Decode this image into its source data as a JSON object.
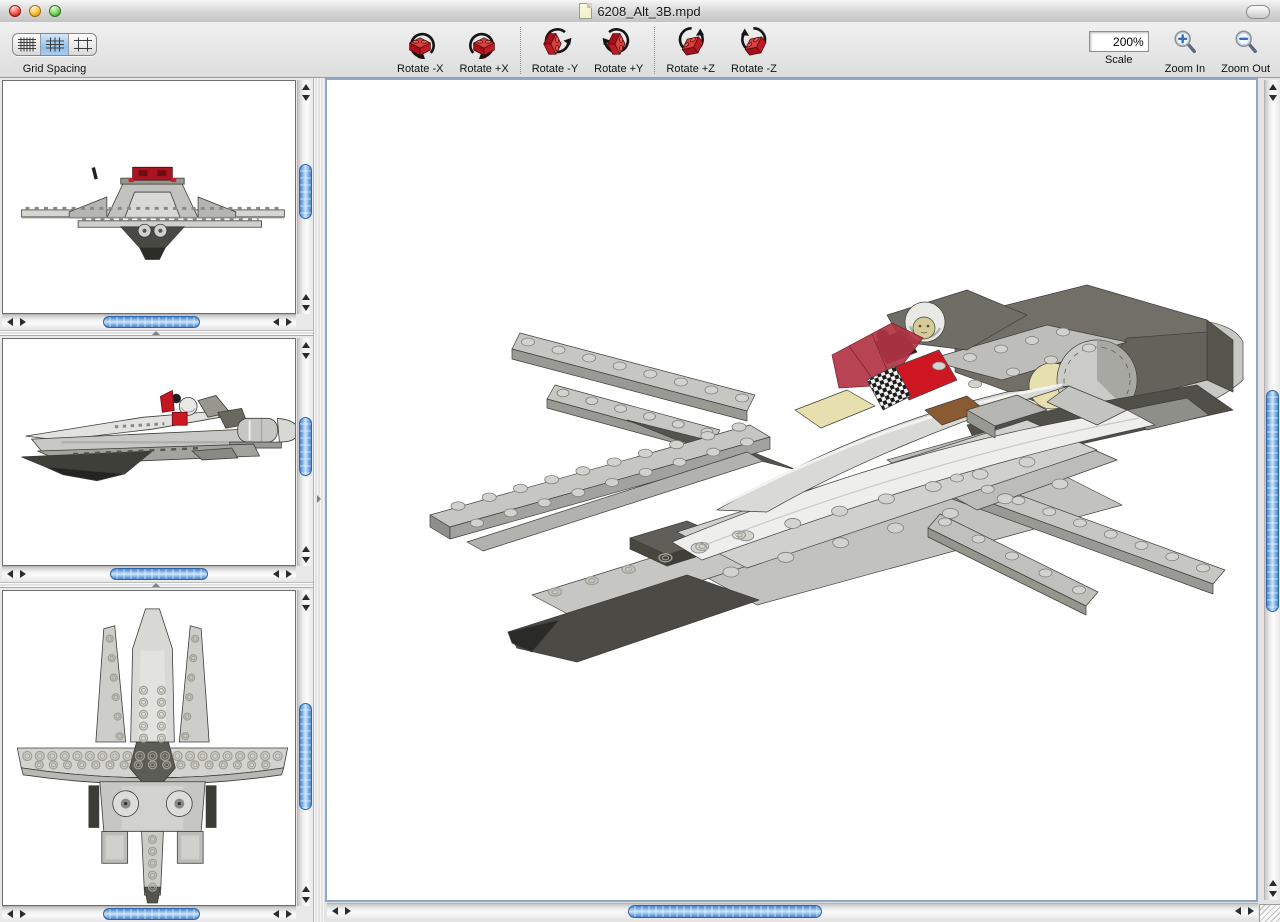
{
  "titlebar": {
    "title": "6208_Alt_3B.mpd"
  },
  "toolbar": {
    "grid_spacing": {
      "label": "Grid Spacing",
      "segments": [
        {
          "id": "fine-grid",
          "selected": false
        },
        {
          "id": "medium-grid",
          "selected": true
        },
        {
          "id": "coarse-grid",
          "selected": false
        }
      ]
    },
    "rotate": {
      "buttons": [
        {
          "label": "Rotate -X"
        },
        {
          "label": "Rotate +X"
        },
        {
          "label": "Rotate -Y"
        },
        {
          "label": "Rotate +Y"
        },
        {
          "label": "Rotate +Z"
        },
        {
          "label": "Rotate -Z"
        }
      ]
    },
    "scale": {
      "label": "Scale",
      "value": "200%"
    },
    "zoom_in": {
      "label": "Zoom In"
    },
    "zoom_out": {
      "label": "Zoom Out"
    }
  },
  "colors": {
    "segment_selected_blue": "#8fc0ea",
    "scrollbar_thumb_blue": "#85b4e8",
    "lego_brick_red": "#cc1620",
    "canvas_border": "#8fa9c4"
  }
}
